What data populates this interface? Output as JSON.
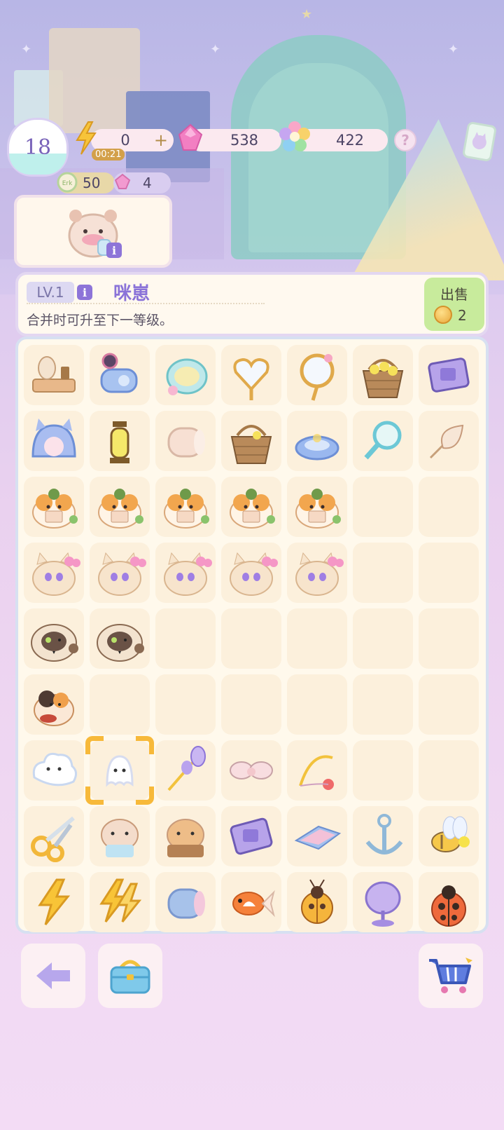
{
  "hud": {
    "level": "18",
    "energy": "0",
    "energy_plus": "+",
    "energy_timer": "00:21",
    "gems": "538",
    "flowers": "422",
    "help": "?",
    "coins": "50",
    "tickets": "4"
  },
  "selected_item": {
    "level_tag": "LV.1",
    "name": "咪崽",
    "description": "合并时可升至下一等级。",
    "info_glyph": "i"
  },
  "sell": {
    "label": "出售",
    "price": "2"
  },
  "board": {
    "columns": 7,
    "rows": 9,
    "selected_cell": "row6-col1",
    "items": [
      [
        "spool-table",
        "cat-hairdryer",
        "cat-bowl",
        "heart-racket",
        "flower-racket",
        "flower-basket",
        "purple-device"
      ],
      [
        "cat-tunnel",
        "lantern",
        "yarn-roll",
        "wicker-basket",
        "cat-bed",
        "magnifier",
        "feather-toy"
      ],
      [
        "calico-cat-letter",
        "calico-cat-letter",
        "calico-cat-letter",
        "calico-cat-letter",
        "calico-cat-letter",
        "",
        ""
      ],
      [
        "cream-kitten-bow",
        "cream-kitten-bow",
        "cream-kitten-bow",
        "cream-kitten-bow",
        "cream-kitten-bow",
        "",
        ""
      ],
      [
        "siamese-cat",
        "siamese-cat",
        "",
        "",
        "",
        "",
        ""
      ],
      [
        "calico-kitten-mizai",
        "",
        "",
        "",
        "",
        "",
        ""
      ],
      [
        "cloud-ghost",
        "small-ghost",
        "purple-flower-wand",
        "ribbon-bow",
        "fishing-rod",
        "",
        ""
      ],
      [
        "scissors",
        "hamster-cup",
        "hamster-box",
        "purple-mat",
        "folded-cloth",
        "anchor-toy",
        "bee"
      ],
      [
        "energy-bolt",
        "energy-bolt-double",
        "rolled-blanket",
        "goldfish",
        "yellow-ladybug",
        "satellite-dish",
        "red-ladybug"
      ]
    ]
  },
  "bottom_bar": {
    "back": "back-arrow-icon",
    "inventory": "basket-icon",
    "shop": "cart-icon"
  },
  "colors": {
    "accent_purple": "#8a73d8",
    "sell_green": "#c8eb9c",
    "selection_orange": "#f7b93a",
    "board_bg": "#fff9ec",
    "cell_bg": "#fcf0dc"
  }
}
